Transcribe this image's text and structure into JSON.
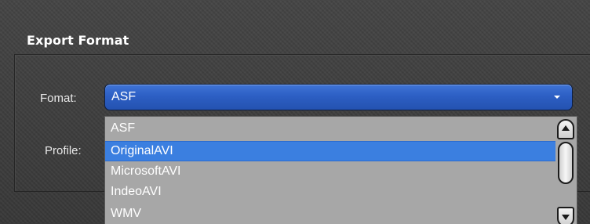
{
  "section": {
    "title": "Export Format"
  },
  "format": {
    "label": "Fomat:",
    "selected": "ASF",
    "options": [
      "ASF",
      "OriginalAVI",
      "MicrosoftAVI",
      "IndeoAVI",
      "WMV"
    ],
    "highlighted_index": 1
  },
  "profile": {
    "label": "Profile:"
  },
  "colors": {
    "select_accent": "#2d5fc4",
    "highlight": "#3b7fe0",
    "list_background": "#a7a7a7",
    "panel_background": "#3a3a3a"
  },
  "icons": {
    "select_arrow": "chevron-down-icon",
    "scroll_up": "scroll-up-arrow-icon",
    "scroll_down": "scroll-down-arrow-icon"
  }
}
